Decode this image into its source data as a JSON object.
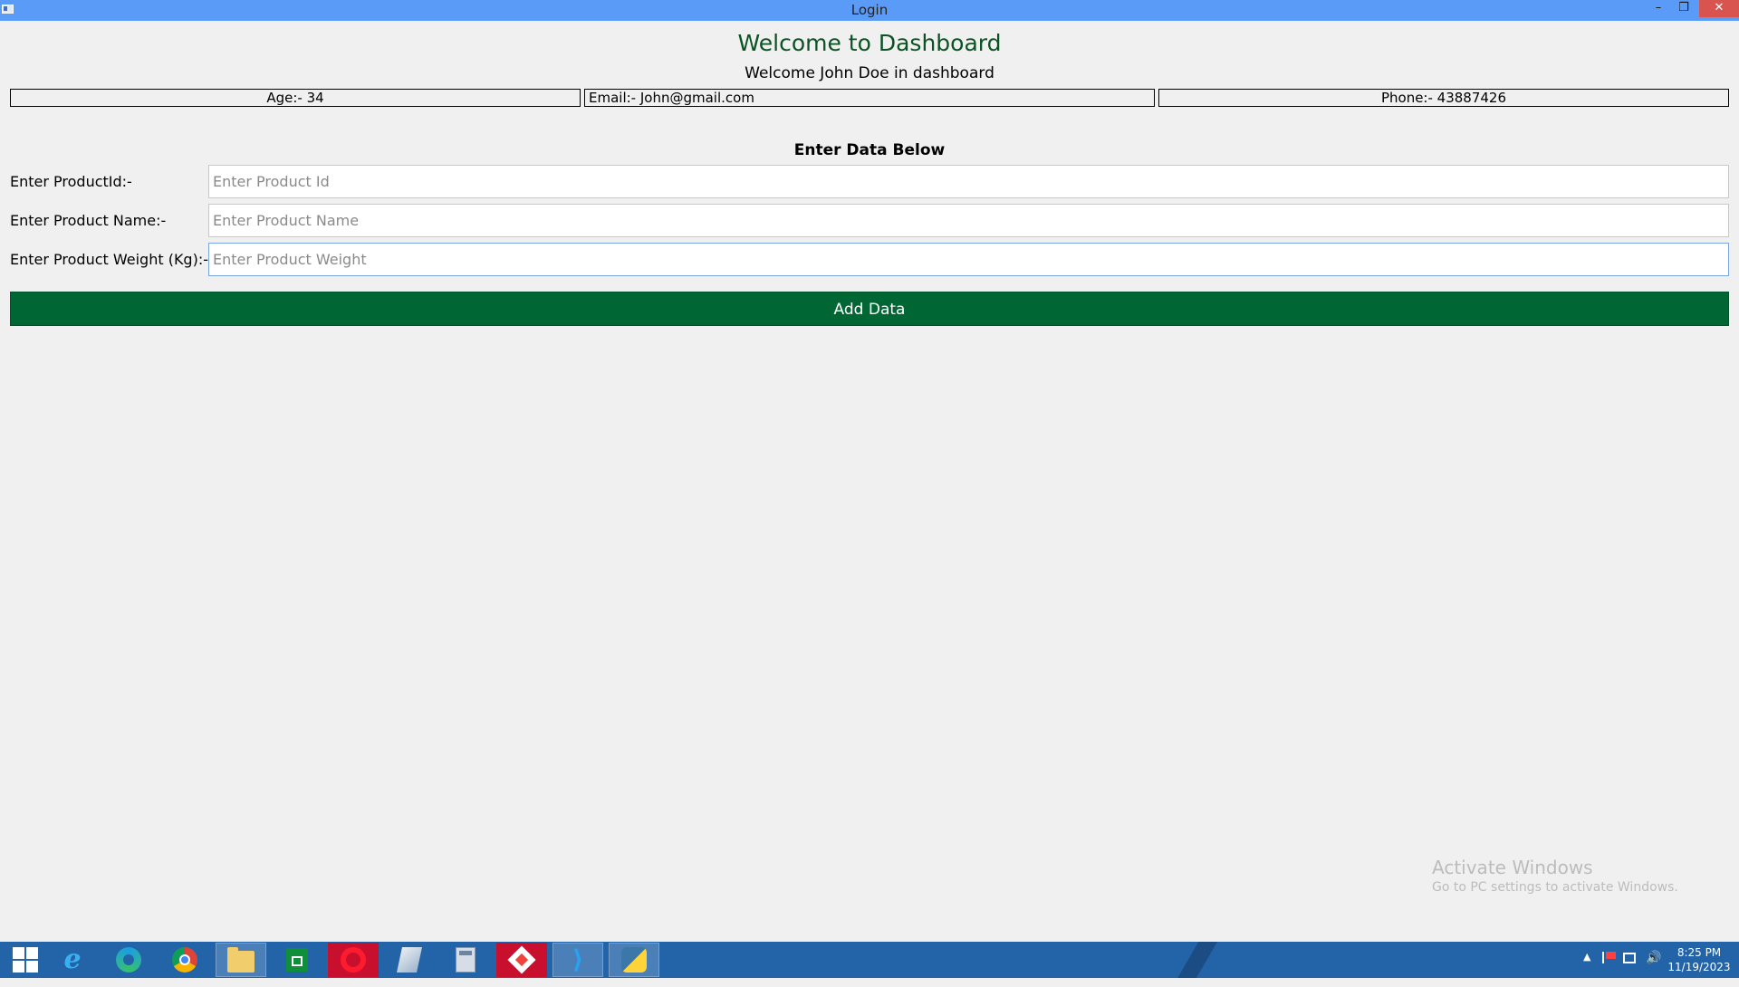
{
  "window": {
    "title": "Login",
    "controls": {
      "minimize": "–",
      "maximize": "❐",
      "close": "✕"
    }
  },
  "header": {
    "welcome_title": "Welcome to Dashboard",
    "welcome_subtitle": "Welcome John Doe in dashboard"
  },
  "info": {
    "age": "Age:- 34",
    "email": "Email:- John@gmail.com",
    "phone": "Phone:- 43887426"
  },
  "form": {
    "section_title": "Enter Data Below",
    "fields": [
      {
        "label": "Enter ProductId:-",
        "placeholder": "Enter Product Id",
        "value": ""
      },
      {
        "label": "Enter Product Name:-",
        "placeholder": "Enter Product Name",
        "value": ""
      },
      {
        "label": "Enter Product Weight (Kg):-",
        "placeholder": "Enter Product Weight",
        "value": ""
      }
    ],
    "submit_label": "Add Data"
  },
  "watermark": {
    "title": "Activate Windows",
    "subtitle": "Go to PC settings to activate Windows."
  },
  "taskbar": {
    "apps": [
      "windows-start",
      "internet-explorer",
      "edge",
      "chrome",
      "file-explorer",
      "store",
      "opera",
      "notepad",
      "calculator",
      "anydesk",
      "vscode",
      "python"
    ],
    "clock": {
      "time": "8:25 PM",
      "date": "11/19/2023"
    },
    "tray_arrow": "▲",
    "tray_volume": "🔊"
  },
  "colors": {
    "titlebar": "#5b9bf8",
    "heading_green": "#0b5323",
    "button_green": "#006633",
    "taskbar": "#2363a8"
  }
}
